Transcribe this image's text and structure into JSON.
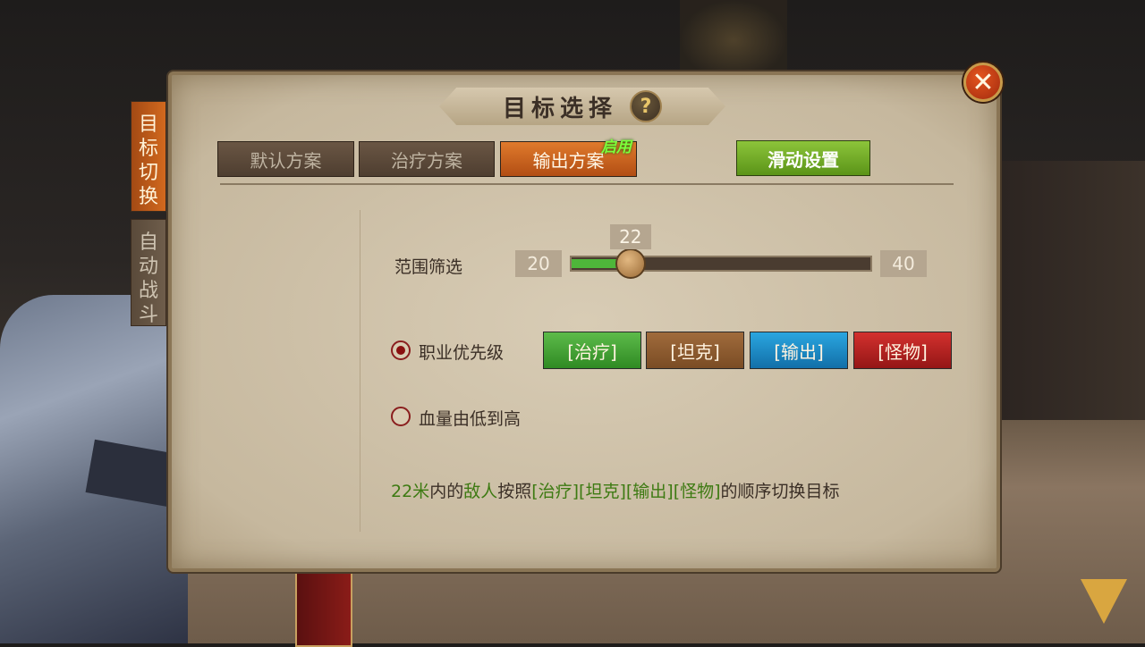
{
  "dialog": {
    "title": "目标选择",
    "help_icon": "?",
    "close_icon": "close-icon"
  },
  "side_tabs": [
    {
      "label": "目标切换",
      "active": true
    },
    {
      "label": "自动战斗",
      "active": false
    }
  ],
  "scheme_tabs": [
    {
      "label": "默认方案",
      "active": false
    },
    {
      "label": "治疗方案",
      "active": false
    },
    {
      "label": "输出方案",
      "active": true,
      "badge": "启用"
    }
  ],
  "slide_settings_label": "滑动设置",
  "range_filter": {
    "label": "范围筛选",
    "min": "20",
    "max": "40",
    "value": "22",
    "value_num": 22
  },
  "options": {
    "class_priority_label": "职业优先级",
    "class_priority_selected": true,
    "hp_low_to_high_label": "血量由低到高",
    "hp_low_to_high_selected": false
  },
  "class_buttons": [
    {
      "label": "[治疗]",
      "color": "#3f9e32"
    },
    {
      "label": "[坦克]",
      "color": "#8c5a2e"
    },
    {
      "label": "[输出]",
      "color": "#1a88c4"
    },
    {
      "label": "[怪物]",
      "color": "#b82222"
    }
  ],
  "description": {
    "distance": "22米",
    "p1": "内的",
    "enemy": "敌人",
    "p2": "按照",
    "order": "[治疗][坦克][输出][怪物]",
    "p3": "的顺序切换目标"
  },
  "colors": {
    "accent_orange": "#d2691e",
    "accent_green": "#5b9418",
    "text_green": "#3d7a12"
  },
  "corner_icon": "arrow-down-icon"
}
